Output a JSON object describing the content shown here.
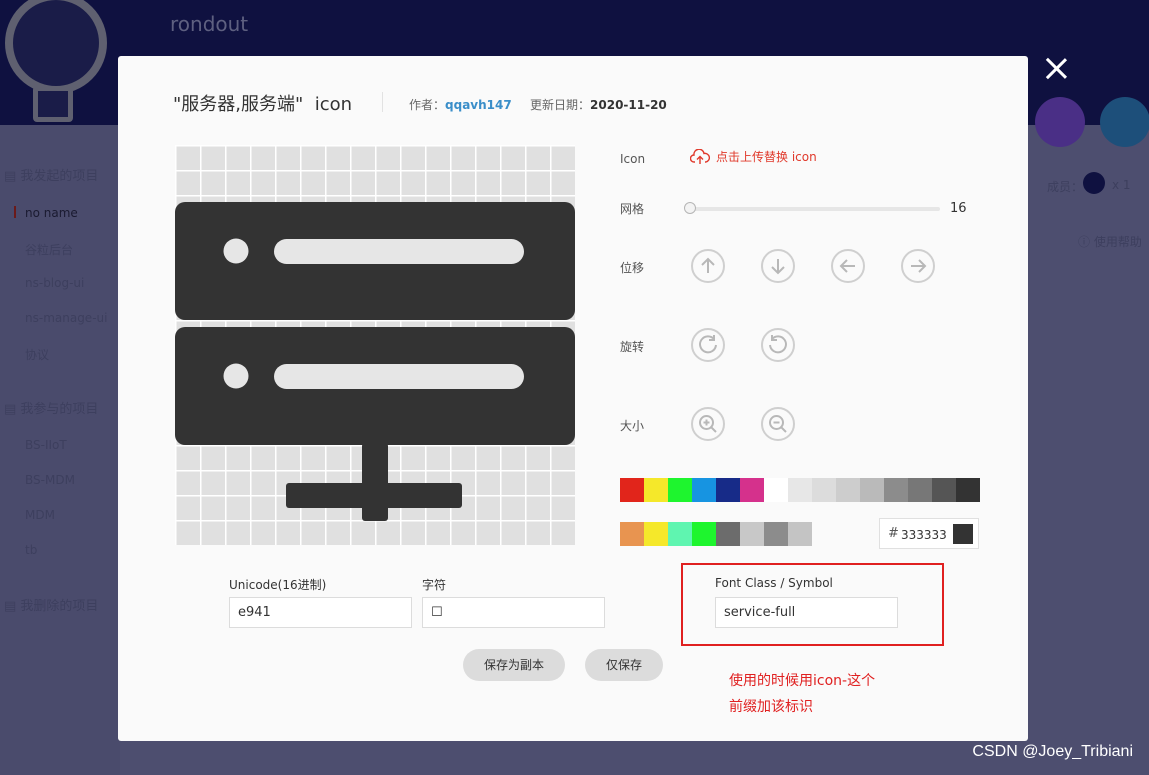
{
  "background": {
    "app_title": "rondout",
    "sections": [
      {
        "label": "我发起的项目",
        "items": [
          "no name",
          "谷粒后台",
          "ns-blog-ui",
          "ns-manage-ui",
          "协议"
        ]
      },
      {
        "label": "我参与的项目",
        "items": [
          "BS-IIoT",
          "BS-MDM",
          "MDM",
          "tb"
        ]
      },
      {
        "label": "我删除的项目",
        "items": []
      }
    ],
    "members_label": "成员：",
    "members_count": "x 1",
    "help_label": "使用帮助"
  },
  "modal": {
    "title": "\"服务器,服务端\"  icon",
    "author_label": "作者：",
    "author": "qqavh147",
    "date_label": "更新日期：",
    "date": "2020-11-20",
    "icon_label": "Icon",
    "upload_label": "点击上传替换 icon",
    "grid_label": "网格",
    "grid_value": "16",
    "move_label": "位移",
    "rotate_label": "旋转",
    "size_label": "大小",
    "palette_row1": [
      "#e1251b",
      "#f5e82a",
      "#1ef52e",
      "#1794e1",
      "#172b88",
      "#d5318c",
      "#ffffff",
      "#e7e7e7",
      "#dcdcdc",
      "#cdcdcd",
      "#bababa",
      "#8c8c8c",
      "#777777",
      "#555555",
      "#333333"
    ],
    "palette_row2": [
      "#e89450",
      "#f5e82a",
      "#5ff5b0",
      "#1ef52e",
      "#6c6c6c",
      "#c8c8c8",
      "#8c8c8c",
      "#c4c4c4"
    ],
    "hex_hash": "#",
    "hex_value": "333333",
    "hex_color": "#333333",
    "unicode_label": "Unicode(16进制)",
    "unicode_value": "e941",
    "char_label": "字符",
    "char_value": "☐",
    "font_class_label": "Font Class / Symbol",
    "font_class_value": "service-full",
    "save_copy_label": "保存为副本",
    "save_only_label": "仅保存",
    "note_line1": "使用的时候用icon-这个",
    "note_line2": "前缀加该标识"
  },
  "watermark": "CSDN @Joey_Tribiani"
}
